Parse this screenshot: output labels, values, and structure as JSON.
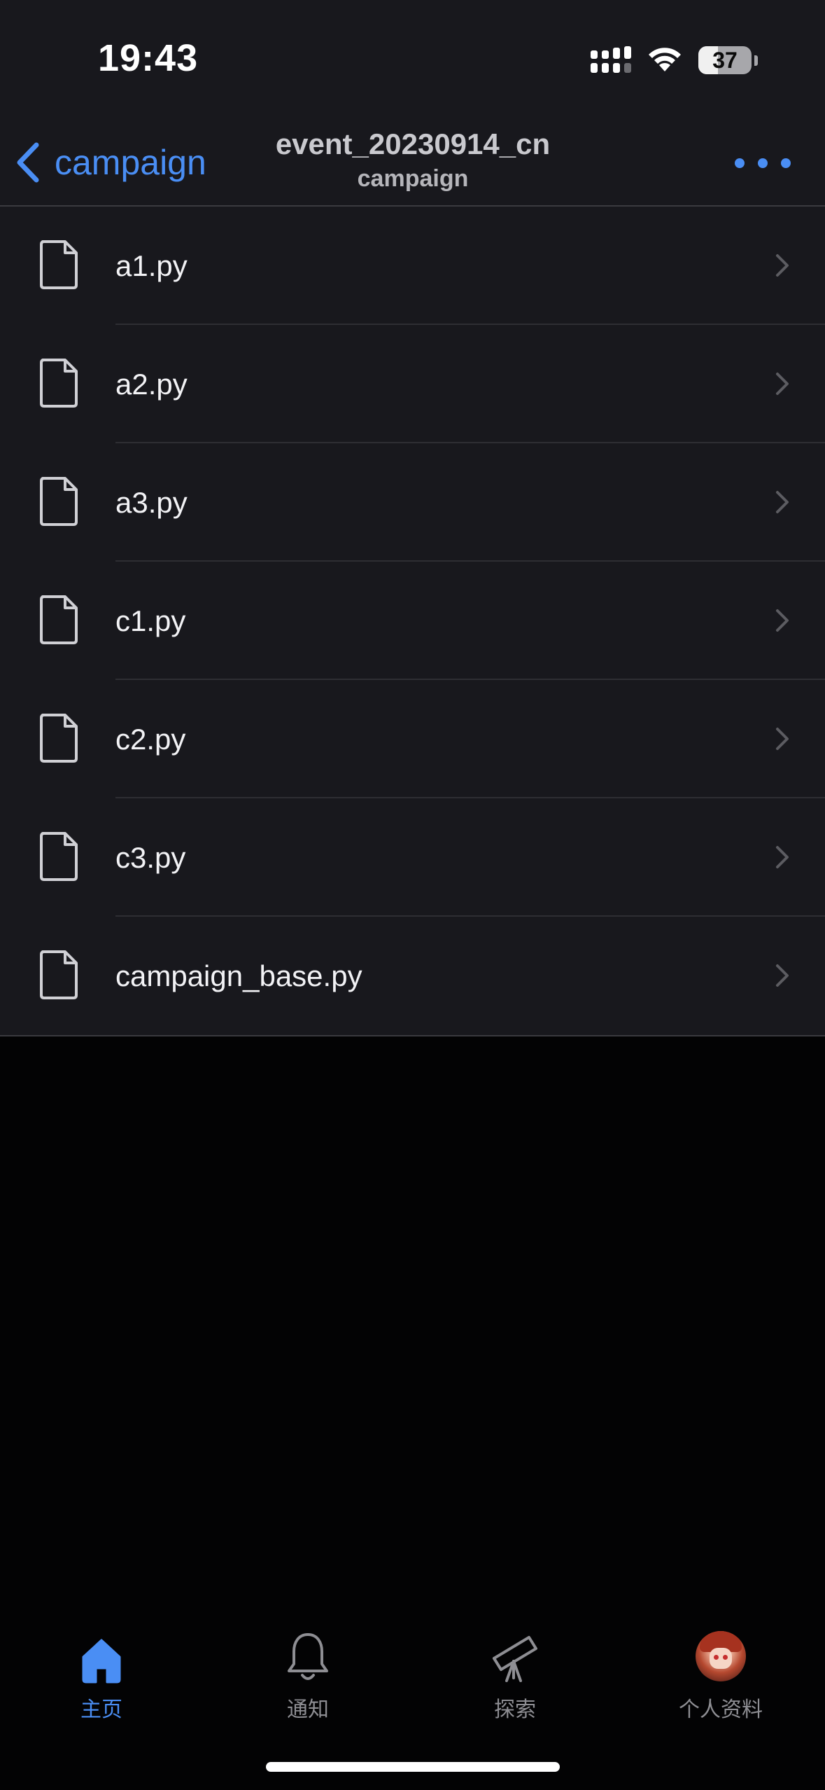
{
  "status_bar": {
    "time": "19:43",
    "battery_percent": "37",
    "battery_level": 0.37,
    "icons": [
      "signal-icon",
      "wifi-icon",
      "battery-icon"
    ]
  },
  "nav": {
    "back_label": "campaign",
    "title": "event_20230914_cn",
    "subtitle": "campaign",
    "more_icon": "ellipsis-icon",
    "accent_color": "#4a8ef4"
  },
  "files": [
    {
      "name": "a1.py",
      "icon": "file-icon"
    },
    {
      "name": "a2.py",
      "icon": "file-icon"
    },
    {
      "name": "a3.py",
      "icon": "file-icon"
    },
    {
      "name": "c1.py",
      "icon": "file-icon"
    },
    {
      "name": "c2.py",
      "icon": "file-icon"
    },
    {
      "name": "c3.py",
      "icon": "file-icon"
    },
    {
      "name": "campaign_base.py",
      "icon": "file-icon"
    }
  ],
  "tabs": [
    {
      "label": "主页",
      "icon": "home-icon",
      "active": true
    },
    {
      "label": "通知",
      "icon": "bell-icon",
      "active": false
    },
    {
      "label": "探索",
      "icon": "telescope-icon",
      "active": false
    },
    {
      "label": "个人资料",
      "icon": "avatar",
      "active": false
    }
  ]
}
